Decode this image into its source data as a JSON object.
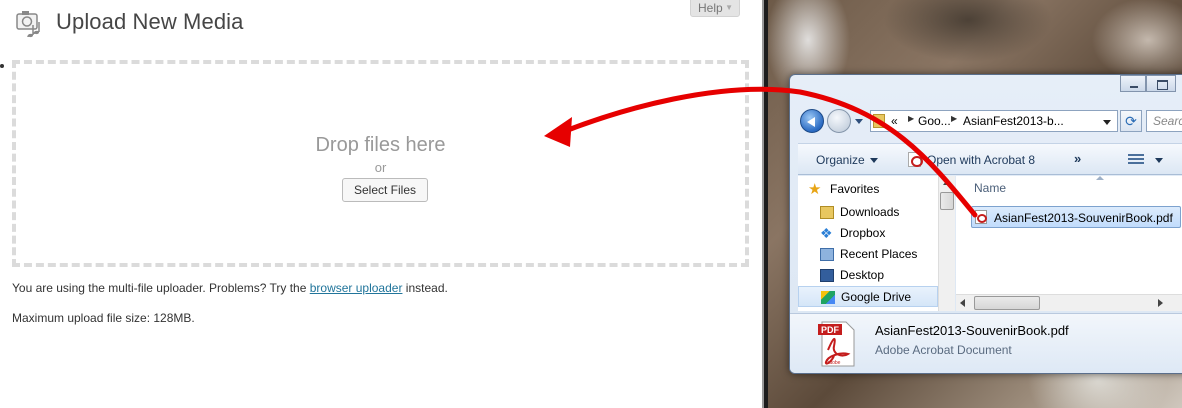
{
  "wordpress": {
    "page_title": "Upload New Media",
    "help_label": "Help",
    "drop_text": "Drop files here",
    "or_text": "or",
    "select_files_label": "Select Files",
    "note_prefix": "You are using the multi-file uploader. Problems? Try the",
    "note_link": "browser uploader",
    "note_suffix": "instead.",
    "max_size": "Maximum upload file size: 128MB."
  },
  "explorer": {
    "address": {
      "chevrons": "«",
      "part1": "Goo...",
      "part2": "AsianFest2013-b..."
    },
    "search_placeholder": "Searc",
    "toolbar": {
      "organize": "Organize",
      "open_with": "Open with Acrobat 8",
      "more": "»"
    },
    "nav": {
      "favorites": "Favorites",
      "items": [
        {
          "label": "Downloads",
          "icon": "downloads-folder-icon"
        },
        {
          "label": "Dropbox",
          "icon": "dropbox-icon"
        },
        {
          "label": "Recent Places",
          "icon": "recent-places-icon"
        },
        {
          "label": "Desktop",
          "icon": "desktop-icon"
        },
        {
          "label": "Google Drive",
          "icon": "google-drive-icon",
          "selected": true
        }
      ]
    },
    "files": {
      "column_name": "Name",
      "items": [
        {
          "name": "AsianFest2013-SouvenirBook.pdf",
          "icon": "pdf-file-icon",
          "selected": true
        }
      ]
    },
    "details": {
      "file_name": "AsianFest2013-SouvenirBook.pdf",
      "file_type": "Adobe Acrobat Document",
      "icon_label": "PDF",
      "brand": "Adobe"
    }
  },
  "colors": {
    "annotation_arrow": "#e60000",
    "wp_link": "#21759b",
    "acrobat_red": "#c41d1d"
  }
}
